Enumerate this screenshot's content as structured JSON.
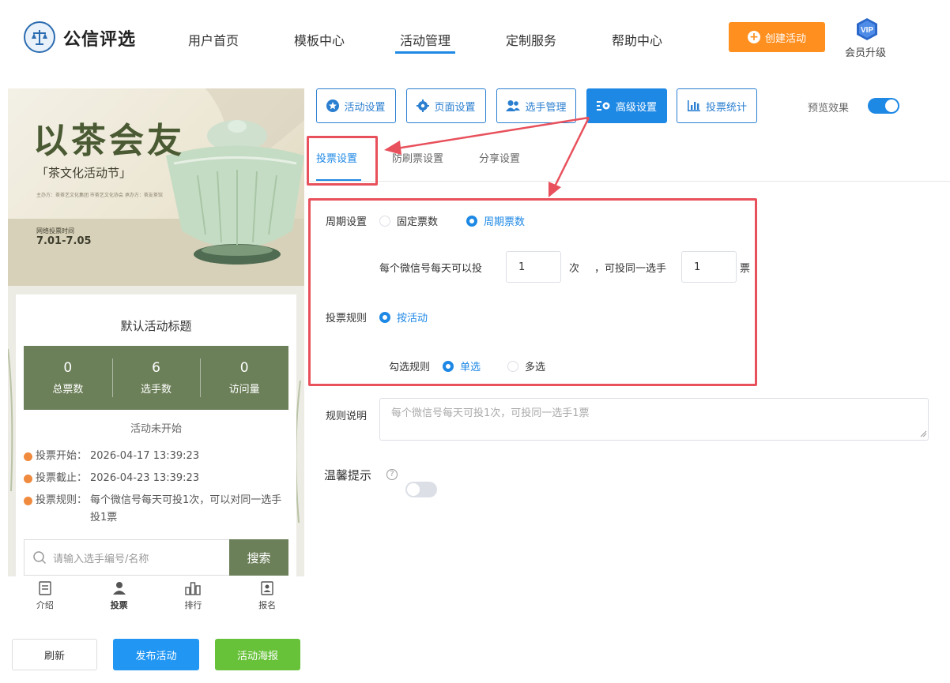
{
  "brand": {
    "name": "公信评选"
  },
  "nav": {
    "items": [
      "用户首页",
      "模板中心",
      "活动管理",
      "定制服务",
      "帮助中心"
    ],
    "active": "活动管理"
  },
  "header": {
    "create_label": "创建活动",
    "vip_badge": "VIP",
    "vip_label": "会员升级"
  },
  "preview": {
    "poster": {
      "title_art": "以茶会友",
      "subtitle": "「茶文化活动节」",
      "period_label": "网络投票时间",
      "period": "7.01-7.05",
      "organizer_line": "主办方：茶茶艺文化集团  市茶艺文化协会  承办方：茶友茶馆"
    },
    "activity_title": "默认活动标题",
    "stats": [
      {
        "value": "0",
        "label": "总票数"
      },
      {
        "value": "6",
        "label": "选手数"
      },
      {
        "value": "0",
        "label": "访问量"
      }
    ],
    "status": "活动未开始",
    "info": [
      {
        "label": "投票开始：",
        "value": "2026-04-17 13:39:23"
      },
      {
        "label": "投票截止：",
        "value": "2026-04-23 13:39:23"
      },
      {
        "label": "投票规则：",
        "value": "每个微信号每天可投1次，可以对同一选手投1票"
      }
    ],
    "search_placeholder": "请输入选手编号/名称",
    "search_button": "搜索",
    "bottom_nav": [
      "介绍",
      "投票",
      "排行",
      "报名"
    ]
  },
  "actions": {
    "refresh": "刷新",
    "publish": "发布活动",
    "poster": "活动海报"
  },
  "settings_tabs": {
    "items": [
      "活动设置",
      "页面设置",
      "选手管理",
      "高级设置",
      "投票统计"
    ],
    "active": "高级设置"
  },
  "preview_toggle": {
    "label": "预览效果",
    "on": true
  },
  "sub_tabs": {
    "items": [
      "投票设置",
      "防刷票设置",
      "分享设置"
    ],
    "active": "投票设置"
  },
  "vote_settings": {
    "period_label": "周期设置",
    "period_options": [
      "固定票数",
      "周期票数"
    ],
    "period_selected": "周期票数",
    "daily_prefix": "每个微信号每天可以投",
    "daily_value": "1",
    "daily_unit": "次",
    "same_prefix": "，可投同一选手",
    "same_value": "1",
    "same_unit": "票",
    "rule_label": "投票规则",
    "rule_option": "按活动",
    "check_label": "勾选规则",
    "check_options": [
      "单选",
      "多选"
    ],
    "check_selected": "单选",
    "desc_label": "规则说明",
    "desc_placeholder": "每个微信号每天可投1次，可投同一选手1票",
    "tip_label": "温馨提示",
    "tip_on": false
  },
  "colors": {
    "primary": "#1e88e5",
    "orange": "#ff8f1f",
    "green": "#67c23a",
    "olive": "#6b7f58",
    "highlight_red": "#e8505b"
  }
}
